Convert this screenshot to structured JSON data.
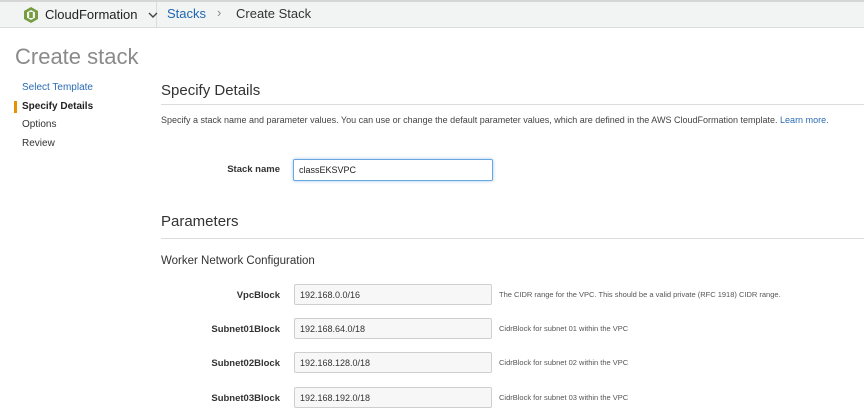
{
  "header": {
    "service_name": "CloudFormation",
    "breadcrumb": {
      "link": "Stacks",
      "separator": "›",
      "current": "Create Stack"
    }
  },
  "page": {
    "title": "Create stack"
  },
  "steps": [
    {
      "label": "Select Template",
      "state": "link"
    },
    {
      "label": "Specify Details",
      "state": "active"
    },
    {
      "label": "Options",
      "state": "inactive"
    },
    {
      "label": "Review",
      "state": "inactive"
    }
  ],
  "details": {
    "title": "Specify Details",
    "description": "Specify a stack name and parameter values. You can use or change the default parameter values, which are defined in the AWS CloudFormation template.",
    "learn_more": "Learn more.",
    "stack_name_label": "Stack name",
    "stack_name_value": "classEKSVPC"
  },
  "parameters": {
    "title": "Parameters",
    "group_title": "Worker Network Configuration",
    "fields": [
      {
        "label": "VpcBlock",
        "value": "192.168.0.0/16",
        "help": "The CIDR range for the VPC. This should be a valid private (RFC 1918) CIDR range."
      },
      {
        "label": "Subnet01Block",
        "value": "192.168.64.0/18",
        "help": "CidrBlock for subnet 01 within the VPC"
      },
      {
        "label": "Subnet02Block",
        "value": "192.168.128.0/18",
        "help": "CidrBlock for subnet 02 within the VPC"
      },
      {
        "label": "Subnet03Block",
        "value": "192.168.192.0/18",
        "help": "CidrBlock for subnet 03 within the VPC"
      }
    ]
  },
  "colors": {
    "link": "#2a6bb3",
    "active_step_marker": "#e59400",
    "focus_border": "#6aa7de"
  },
  "icons": {
    "service": "cloudformation-icon",
    "dropdown": "chevron-down-icon"
  }
}
